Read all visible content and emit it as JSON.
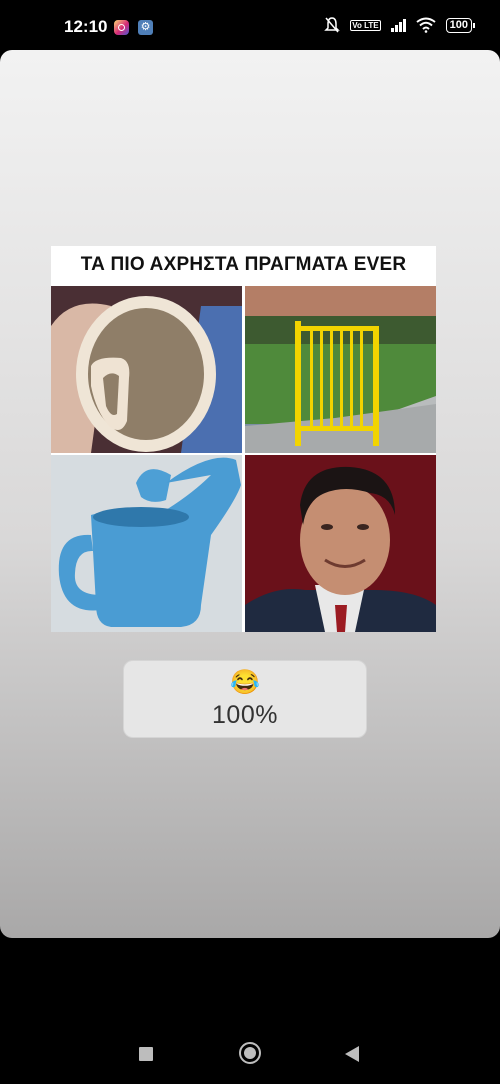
{
  "status_bar": {
    "time": "12:10",
    "volte": "Vo LTE",
    "battery": "100"
  },
  "story": {
    "meme_title": "ΤΑ ΠΙΟ ΑΧΡΗΣΤΑ ΠΡΑΓΜΑΤΑ EVER",
    "tiles": [
      "mug-with-inside-handle-image",
      "standalone-yellow-gate-image",
      "blue-watering-can-image",
      "man-portrait-image"
    ]
  },
  "poll_sticker": {
    "emoji": "😂",
    "value": "100%"
  },
  "nav_bar": {
    "icons": [
      "recents-square-icon",
      "home-circle-icon",
      "back-triangle-icon"
    ]
  }
}
